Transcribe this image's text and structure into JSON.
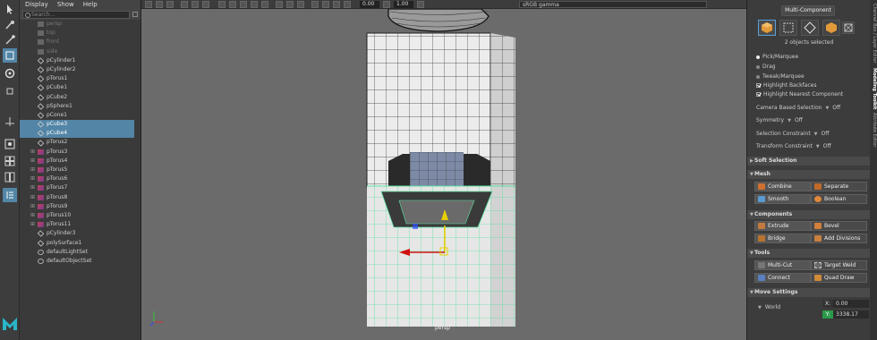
{
  "outliner": {
    "menu": [
      "Display",
      "Show",
      "Help"
    ],
    "search_placeholder": "Search...",
    "items": [
      {
        "label": "persp",
        "type": "camera",
        "dim": true
      },
      {
        "label": "top",
        "type": "camera",
        "dim": true
      },
      {
        "label": "front",
        "type": "camera",
        "dim": true
      },
      {
        "label": "side",
        "type": "camera",
        "dim": true
      },
      {
        "label": "pCylinder1",
        "type": "mesh"
      },
      {
        "label": "pCylinder2",
        "type": "mesh"
      },
      {
        "label": "pTorus1",
        "type": "mesh"
      },
      {
        "label": "pCube1",
        "type": "mesh"
      },
      {
        "label": "pCube2",
        "type": "mesh"
      },
      {
        "label": "pSphere1",
        "type": "mesh"
      },
      {
        "label": "pCone1",
        "type": "mesh"
      },
      {
        "label": "pCube3",
        "type": "mesh",
        "selected": true
      },
      {
        "label": "pCube4",
        "type": "mesh",
        "selected": true
      },
      {
        "label": "pTorus2",
        "type": "mesh"
      },
      {
        "label": "pTorus3",
        "type": "group"
      },
      {
        "label": "pTorus4",
        "type": "group"
      },
      {
        "label": "pTorus5",
        "type": "group"
      },
      {
        "label": "pTorus6",
        "type": "group"
      },
      {
        "label": "pTorus7",
        "type": "group"
      },
      {
        "label": "pTorus8",
        "type": "group"
      },
      {
        "label": "pTorus9",
        "type": "group"
      },
      {
        "label": "pTorus10",
        "type": "group"
      },
      {
        "label": "pTorus11",
        "type": "group"
      },
      {
        "label": "pCylinder3",
        "type": "mesh"
      },
      {
        "label": "polySurface1",
        "type": "mesh"
      },
      {
        "label": "defaultLightSet",
        "type": "set"
      },
      {
        "label": "defaultObjectSet",
        "type": "set"
      }
    ]
  },
  "viewport": {
    "field_value_1": "0.00",
    "field_value_2": "1.00",
    "color_space": "sRGB gamma",
    "camera_label": "persp"
  },
  "modeling": {
    "title": "Multi-Component",
    "objects_selected": "2 objects selected",
    "pick_options": [
      "Pick/Marquee",
      "Drag",
      "Tweak/Marquee"
    ],
    "checkboxes": [
      "Highlight Backfaces",
      "Highlight Nearest Component"
    ],
    "camera_based_selection": {
      "label": "Camera Based Selection",
      "value": "Off"
    },
    "symmetry": {
      "label": "Symmetry",
      "value": "Off"
    },
    "selection_constraint": {
      "label": "Selection Constraint",
      "value": "Off"
    },
    "transform_constraint": {
      "label": "Transform Constraint",
      "value": "Off"
    },
    "soft_selection": "Soft Selection",
    "sections": {
      "mesh": {
        "title": "Mesh",
        "buttons": [
          "Combine",
          "Separate",
          "Smooth",
          "Boolean"
        ]
      },
      "components": {
        "title": "Components",
        "buttons": [
          "Extrude",
          "Bevel",
          "Bridge",
          "Add Divisions"
        ]
      },
      "tools": {
        "title": "Tools",
        "buttons": [
          "Multi-Cut",
          "Target Weld",
          "Connect",
          "Quad Draw"
        ]
      }
    },
    "move_settings": {
      "title": "Move Settings",
      "space": "World",
      "x_label": "X:",
      "x_value": "0.00",
      "y_label": "Y:",
      "y_value": "3338.17"
    }
  },
  "side_tabs": [
    "Channel Box / Layer Editor",
    "Modeling Toolkit",
    "Attribute Editor"
  ],
  "colors": {
    "selection": "#5285a6",
    "mesh_highlight": "#5ee0a0",
    "viewport_bg": "#6b6b6b"
  }
}
